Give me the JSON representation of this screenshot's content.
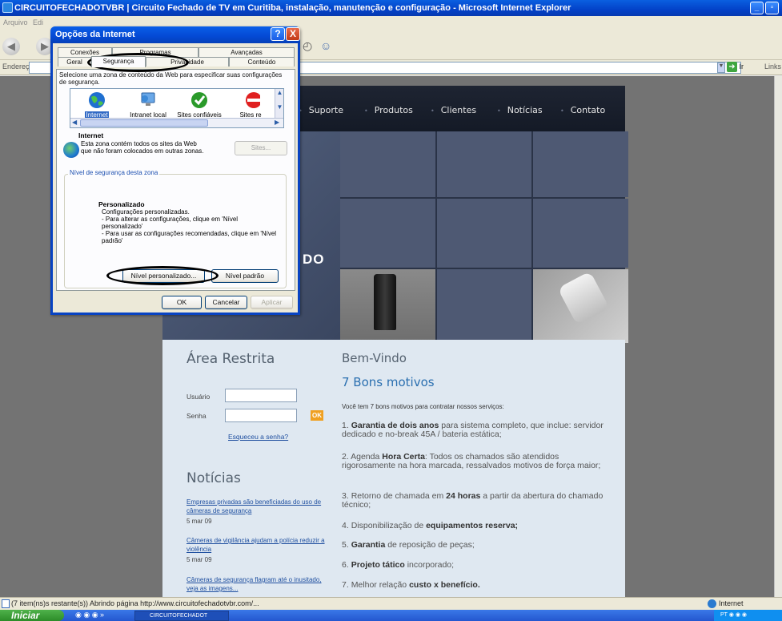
{
  "ie": {
    "window_title": "CIRCUITOFECHADOTVBR | Circuito Fechado de TV em Curitiba, instalação, manutenção e configuração - Microsoft Internet Explorer",
    "menu": [
      "Arquivo",
      "Edi"
    ],
    "address_label": "Endereço",
    "go_label": "Ir",
    "links_label": "Links",
    "status_text": "(7 item(ns)s restante(s)) Abrindo página http://www.circuitofechadotvbr.com/...",
    "status_zone": "Internet"
  },
  "taskbar": {
    "start_label": "Iniciar",
    "task_label": "CIRCUITOFECHADOT",
    "tray_text": "PT"
  },
  "dialog": {
    "title": "Opções da Internet",
    "help_label": "?",
    "close_label": "X",
    "tabs": [
      "Conexões",
      "Programas",
      "Avançadas",
      "Geral",
      "Segurança",
      "Privacidade",
      "Conteúdo"
    ],
    "zone_prompt": "Selecione uma zona de conteúdo da Web para especificar suas configurações de segurança.",
    "zones": [
      "Internet",
      "Intranet local",
      "Sites confiáveis",
      "Sites re"
    ],
    "zone_info_title": "Internet",
    "zone_info_text": "Esta zona contém todos os sites da Web que não foram colocados em outras zonas.",
    "sites_button": "Sites...",
    "security_level_legend": "Nível de segurança desta zona",
    "custom_title": "Personalizado",
    "custom_text": "Configurações personalizadas.\n- Para alterar as configurações, clique em 'Nível personalizado'\n- Para usar as configurações recomendadas, clique em 'Nível padrão'",
    "custom_level_button": "Nível personalizado...",
    "default_level_button": "Nível padrão",
    "ok_button": "OK",
    "cancel_button": "Cancelar",
    "apply_button": "Aplicar"
  },
  "site": {
    "nav": [
      "Suporte",
      "Produtos",
      "Clientes",
      "Notícias",
      "Contato"
    ],
    "hero_word": "DO",
    "area_restrita": "Área Restrita",
    "usuario_label": "Usuário",
    "senha_label": "Senha",
    "ok_label": "OK",
    "forgot_link": "Esqueceu a senha?",
    "noticias_title": "Notícias",
    "news": [
      {
        "title": "Empresas privadas são beneficiadas do uso de câmeras de segurança",
        "date": "5 mar 09"
      },
      {
        "title": "Câmeras de vigilância ajudam a polícia reduzir a violência",
        "date": "5 mar 09"
      },
      {
        "title": "Câmeras de segurança flagram até o inusitado, veja as imagens..."
      }
    ],
    "bem_vindo": "Bem-Vindo",
    "bons_motivos": "7 Bons motivos",
    "intro": "Você tem 7 bons motivos para contratar nossos serviços:",
    "motivos": [
      {
        "num": "1.",
        "bold": "Garantia de dois anos",
        "text": " para sistema completo, que inclue: servidor dedicado e no-break 45A / bateria estática;"
      },
      {
        "num": "2.",
        "pre": "Agenda ",
        "bold": "Hora Certa",
        "text": ": Todos os chamados são atendidos rigorosamente na hora marcada, ressalvados motivos de força maior;"
      },
      {
        "num": "3.",
        "pre": "Retorno de chamada em ",
        "bold": "24 horas",
        "text": " a partir da abertura do chamado técnico;"
      },
      {
        "num": "4.",
        "pre": "Disponibilização de ",
        "bold": "equipamentos reserva;",
        "text": ""
      },
      {
        "num": "5.",
        "bold": "Garantia",
        "text": " de reposição de peças;"
      },
      {
        "num": "6.",
        "bold": "Projeto tático",
        "text": " incorporado;"
      },
      {
        "num": "7.",
        "pre": "Melhor relação ",
        "bold": "custo x benefício.",
        "text": ""
      }
    ]
  }
}
